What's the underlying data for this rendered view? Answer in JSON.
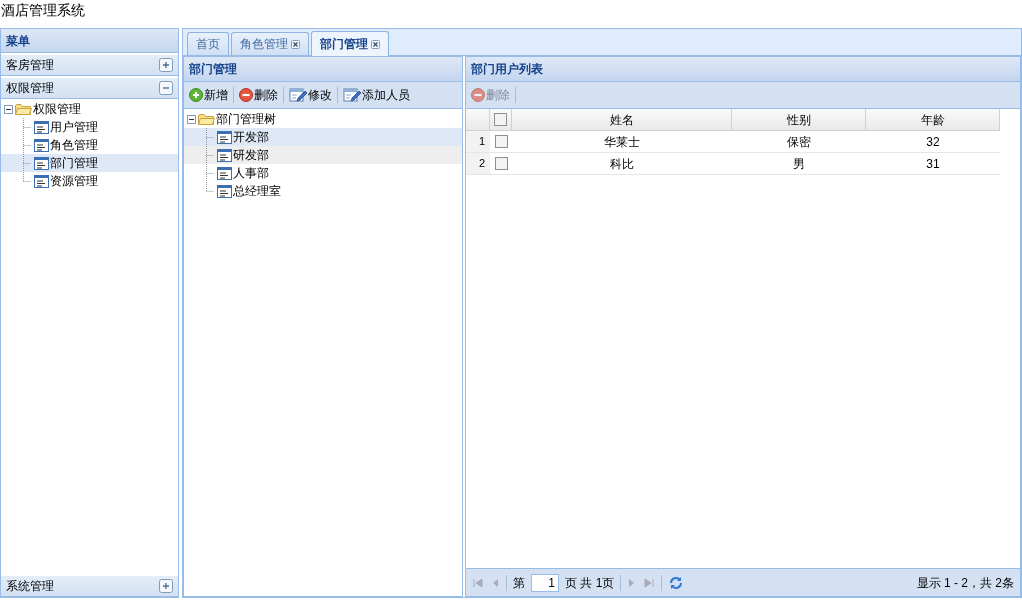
{
  "app_title": "酒店管理系统",
  "menu": {
    "title": "菜单",
    "sections": [
      {
        "label": "客房管理",
        "expanded": false
      },
      {
        "label": "权限管理",
        "expanded": true,
        "tree": [
          {
            "label": "权限管理",
            "expanded": true,
            "children": [
              {
                "label": "用户管理",
                "selected": false
              },
              {
                "label": "角色管理",
                "selected": false
              },
              {
                "label": "部门管理",
                "selected": true
              },
              {
                "label": "资源管理",
                "selected": false
              }
            ]
          }
        ]
      },
      {
        "label": "系统管理",
        "expanded": false
      }
    ]
  },
  "tabs": [
    {
      "label": "首页",
      "closable": false,
      "selected": false
    },
    {
      "label": "角色管理",
      "closable": true,
      "selected": false
    },
    {
      "label": "部门管理",
      "closable": true,
      "selected": true
    }
  ],
  "dept_panel": {
    "title": "部门管理",
    "toolbar": [
      {
        "label": "新增",
        "kind": "add"
      },
      {
        "label": "删除",
        "kind": "remove"
      },
      {
        "label": "修改",
        "kind": "edit"
      },
      {
        "label": "添加人员",
        "kind": "edit"
      }
    ],
    "tree": [
      {
        "label": "部门管理树",
        "expanded": true,
        "children": [
          {
            "label": "开发部",
            "selected": true,
            "hovered": false
          },
          {
            "label": "研发部",
            "selected": false,
            "hovered": true
          },
          {
            "label": "人事部",
            "selected": false,
            "hovered": false
          },
          {
            "label": "总经理室",
            "selected": false,
            "hovered": false
          }
        ]
      }
    ]
  },
  "user_panel": {
    "title": "部门用户列表",
    "toolbar": [
      {
        "label": "删除",
        "kind": "remove",
        "disabled": true
      }
    ],
    "header_checked": false,
    "columns": [
      "姓名",
      "性别",
      "年龄"
    ],
    "rows": [
      {
        "number": "1",
        "checked": false,
        "cells": [
          "华莱士",
          "保密",
          "32"
        ]
      },
      {
        "number": "2",
        "checked": false,
        "cells": [
          "科比",
          "男",
          "31"
        ]
      }
    ],
    "pager": {
      "page_prefix": "第",
      "page_value": "1",
      "page_suffix": "页 共 1页",
      "summary": "显示 1 - 2，共 2条"
    }
  }
}
